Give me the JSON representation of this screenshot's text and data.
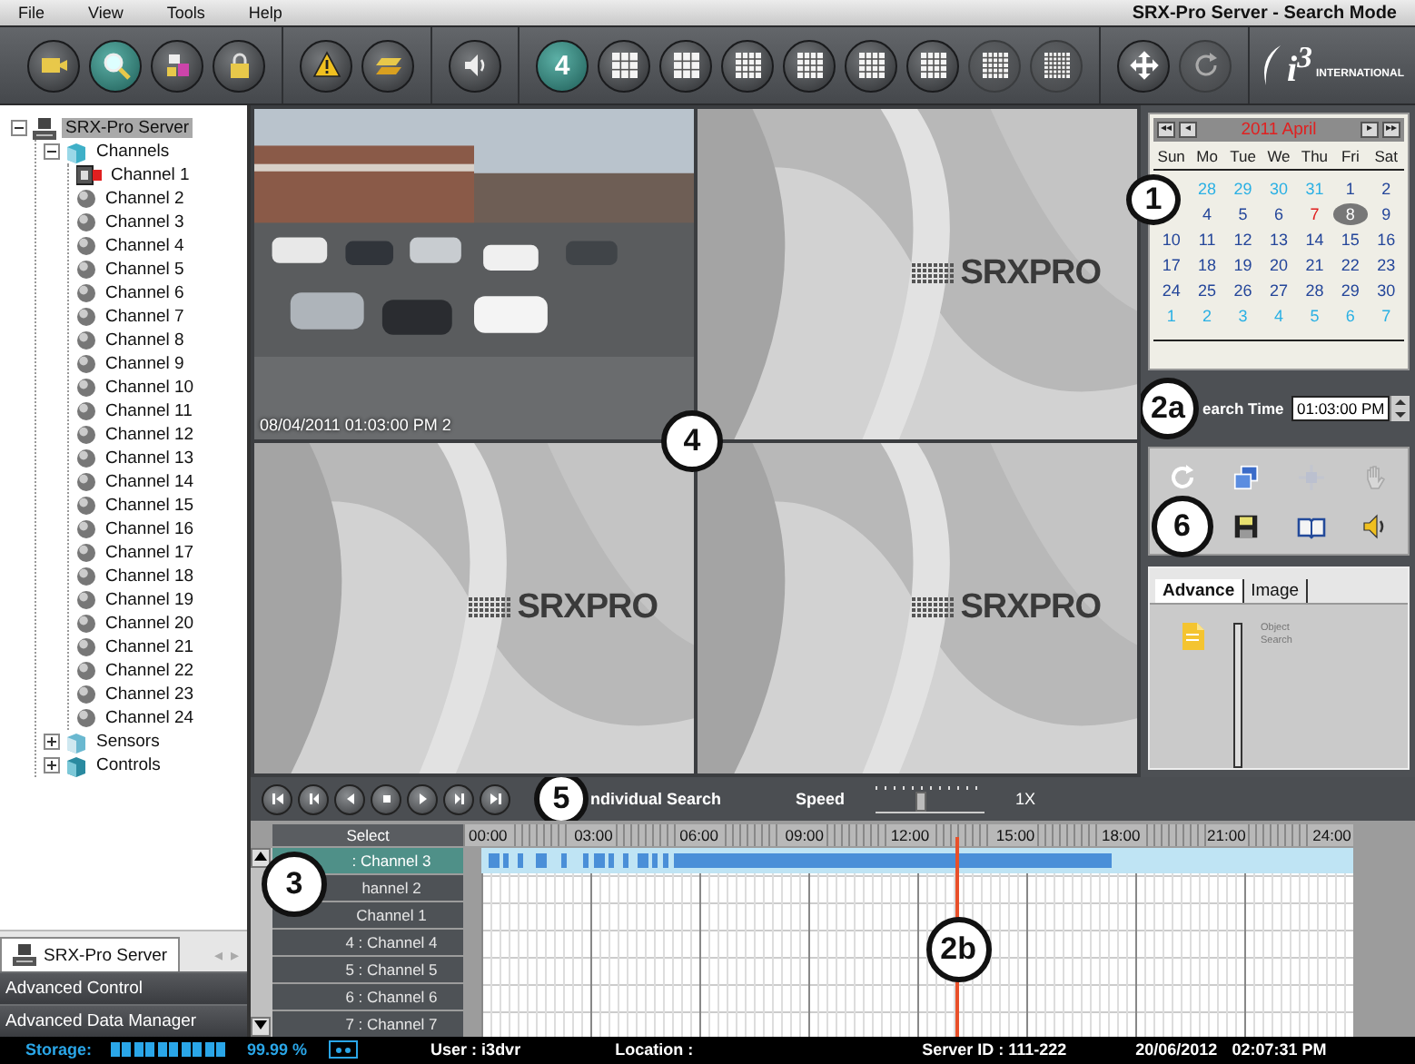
{
  "menu": {
    "items": [
      "File",
      "View",
      "Tools",
      "Help"
    ],
    "title": "SRX-Pro Server - Search Mode"
  },
  "toolbar": {
    "groups": [
      {
        "buttons": [
          {
            "kind": "camera",
            "selected": false,
            "disabled": false
          },
          {
            "kind": "search",
            "selected": true,
            "disabled": false
          },
          {
            "kind": "tools",
            "selected": false,
            "disabled": false
          },
          {
            "kind": "lock",
            "selected": false,
            "disabled": false
          }
        ]
      },
      {
        "buttons": [
          {
            "kind": "warning",
            "selected": false,
            "disabled": false
          },
          {
            "kind": "layers",
            "selected": false,
            "disabled": false
          }
        ]
      },
      {
        "buttons": [
          {
            "kind": "speaker",
            "selected": false,
            "disabled": false
          }
        ]
      },
      {
        "buttons": [
          {
            "kind": "number",
            "label": "4",
            "selected": true,
            "disabled": false
          },
          {
            "kind": "layout-6",
            "selected": false,
            "disabled": false
          },
          {
            "kind": "layout-9",
            "selected": false,
            "disabled": false
          },
          {
            "kind": "layout-8",
            "selected": false,
            "disabled": false
          },
          {
            "kind": "layout-10",
            "selected": false,
            "disabled": false
          },
          {
            "kind": "layout-13",
            "selected": false,
            "disabled": false
          },
          {
            "kind": "layout-16",
            "selected": false,
            "disabled": false
          },
          {
            "kind": "layout-25",
            "selected": false,
            "disabled": true
          },
          {
            "kind": "layout-36",
            "selected": false,
            "disabled": true
          }
        ]
      },
      {
        "buttons": [
          {
            "kind": "move",
            "selected": false,
            "disabled": false
          },
          {
            "kind": "refresh",
            "selected": false,
            "disabled": true
          }
        ]
      }
    ],
    "logo": {
      "mark": "i$^{3}$",
      "subtitle": "INTERNATIONAL"
    }
  },
  "tree": [
    {
      "label": "SRX-Pro Server",
      "kind": "server",
      "expanded": true,
      "selected": true,
      "children": [
        {
          "label": "Channels",
          "kind": "folder",
          "expanded": true,
          "selected": false,
          "children": [
            {
              "label": "Channel 1",
              "kind": "camera-recording",
              "selected": false
            },
            {
              "label": "Channel 2",
              "kind": "camera",
              "selected": false
            },
            {
              "label": "Channel 3",
              "kind": "camera",
              "selected": false
            },
            {
              "label": "Channel 4",
              "kind": "camera",
              "selected": false
            },
            {
              "label": "Channel 5",
              "kind": "camera",
              "selected": false
            },
            {
              "label": "Channel 6",
              "kind": "camera",
              "selected": false
            },
            {
              "label": "Channel 7",
              "kind": "camera",
              "selected": false
            },
            {
              "label": "Channel 8",
              "kind": "camera",
              "selected": false
            },
            {
              "label": "Channel 9",
              "kind": "camera",
              "selected": false
            },
            {
              "label": "Channel 10",
              "kind": "camera",
              "selected": false
            },
            {
              "label": "Channel 11",
              "kind": "camera",
              "selected": false
            },
            {
              "label": "Channel 12",
              "kind": "camera",
              "selected": false
            },
            {
              "label": "Channel 13",
              "kind": "camera",
              "selected": false
            },
            {
              "label": "Channel 14",
              "kind": "camera",
              "selected": false
            },
            {
              "label": "Channel 15",
              "kind": "camera",
              "selected": false
            },
            {
              "label": "Channel 16",
              "kind": "camera",
              "selected": false
            },
            {
              "label": "Channel 17",
              "kind": "camera",
              "selected": false
            },
            {
              "label": "Channel 18",
              "kind": "camera",
              "selected": false
            },
            {
              "label": "Channel 19",
              "kind": "camera",
              "selected": false
            },
            {
              "label": "Channel 20",
              "kind": "camera",
              "selected": false
            },
            {
              "label": "Channel 21",
              "kind": "camera",
              "selected": false
            },
            {
              "label": "Channel 22",
              "kind": "camera",
              "selected": false
            },
            {
              "label": "Channel 23",
              "kind": "camera",
              "selected": false
            },
            {
              "label": "Channel 24",
              "kind": "camera",
              "selected": false
            }
          ]
        },
        {
          "label": "Sensors",
          "kind": "sensor-folder",
          "expanded": false,
          "selected": false
        },
        {
          "label": "Controls",
          "kind": "control-folder",
          "expanded": false,
          "selected": false
        }
      ]
    }
  ],
  "left_tab": {
    "label": "SRX-Pro Server",
    "prev": "◂",
    "next": "▸"
  },
  "left_sections": [
    "Advanced Control",
    "Advanced Data Manager"
  ],
  "video": {
    "callout": "4",
    "tiles": [
      {
        "kind": "camera",
        "caption": "08/04/2011 01:03:00 PM 2"
      },
      {
        "kind": "logo",
        "logo": "SRXPRO"
      },
      {
        "kind": "logo",
        "logo": "SRXPRO"
      },
      {
        "kind": "logo",
        "logo": "SRXPRO"
      }
    ]
  },
  "calendar": {
    "title": "2011 April",
    "first": "◂◂",
    "prev": "◂",
    "next": "▸",
    "last": "▸▸",
    "callout": "1",
    "weekdays": [
      "Sun",
      "Mo",
      "Tue",
      "We",
      "Thu",
      "Fri",
      "Sat"
    ],
    "weeks": [
      [
        {
          "kind": "covered"
        },
        {
          "day": "28",
          "kind": "other-month",
          "selected": false
        },
        {
          "day": "29",
          "kind": "other-month",
          "selected": false
        },
        {
          "day": "30",
          "kind": "other-month",
          "selected": false
        },
        {
          "day": "31",
          "kind": "other-month",
          "selected": false
        },
        {
          "day": "1",
          "kind": "month",
          "selected": false
        },
        {
          "day": "2",
          "kind": "month",
          "selected": false
        }
      ],
      [
        {
          "kind": "covered"
        },
        {
          "day": "4",
          "kind": "month",
          "selected": false
        },
        {
          "day": "5",
          "kind": "month",
          "selected": false
        },
        {
          "day": "6",
          "kind": "month",
          "selected": false
        },
        {
          "day": "7",
          "kind": "marked",
          "selected": false
        },
        {
          "day": "8",
          "kind": "month",
          "selected": true
        },
        {
          "day": "9",
          "kind": "month",
          "selected": false
        }
      ],
      [
        {
          "day": "10",
          "kind": "month",
          "selected": false
        },
        {
          "day": "11",
          "kind": "month",
          "selected": false
        },
        {
          "day": "12",
          "kind": "month",
          "selected": false
        },
        {
          "day": "13",
          "kind": "month",
          "selected": false
        },
        {
          "day": "14",
          "kind": "month",
          "selected": false
        },
        {
          "day": "15",
          "kind": "month",
          "selected": false
        },
        {
          "day": "16",
          "kind": "month",
          "selected": false
        }
      ],
      [
        {
          "day": "17",
          "kind": "month",
          "selected": false
        },
        {
          "day": "18",
          "kind": "month",
          "selected": false
        },
        {
          "day": "19",
          "kind": "month",
          "selected": false
        },
        {
          "day": "20",
          "kind": "month",
          "selected": false
        },
        {
          "day": "21",
          "kind": "month",
          "selected": false
        },
        {
          "day": "22",
          "kind": "month",
          "selected": false
        },
        {
          "day": "23",
          "kind": "month",
          "selected": false
        }
      ],
      [
        {
          "day": "24",
          "kind": "month",
          "selected": false
        },
        {
          "day": "25",
          "kind": "month",
          "selected": false
        },
        {
          "day": "26",
          "kind": "month",
          "selected": false
        },
        {
          "day": "27",
          "kind": "month",
          "selected": false
        },
        {
          "day": "28",
          "kind": "month",
          "selected": false
        },
        {
          "day": "29",
          "kind": "month",
          "selected": false
        },
        {
          "day": "30",
          "kind": "month",
          "selected": false
        }
      ],
      [
        {
          "day": "1",
          "kind": "other-month",
          "selected": false
        },
        {
          "day": "2",
          "kind": "other-month",
          "selected": false
        },
        {
          "day": "3",
          "kind": "other-month",
          "selected": false
        },
        {
          "day": "4",
          "kind": "other-month",
          "selected": false
        },
        {
          "day": "5",
          "kind": "other-month",
          "selected": false
        },
        {
          "day": "6",
          "kind": "other-month",
          "selected": false
        },
        {
          "day": "7",
          "kind": "other-month",
          "selected": false
        }
      ]
    ]
  },
  "search_time": {
    "callout": "2a",
    "label": "earch Time",
    "value": "01:03:00 PM"
  },
  "tools": {
    "callout": "6",
    "icons": [
      {
        "kind": "refresh",
        "disabled": false
      },
      {
        "kind": "windows",
        "disabled": false
      },
      {
        "kind": "move",
        "disabled": true
      },
      {
        "kind": "hand",
        "disabled": true
      },
      {
        "kind": "save",
        "disabled": false
      },
      {
        "kind": "book",
        "disabled": false
      },
      {
        "kind": "speaker",
        "disabled": false
      }
    ]
  },
  "advanced": {
    "tabs": [
      {
        "label": "Advance",
        "selected": true
      },
      {
        "label": "Image",
        "selected": false
      }
    ],
    "item": "Object Search"
  },
  "playback": {
    "buttons": [
      {
        "kind": "first"
      },
      {
        "kind": "prev-mark"
      },
      {
        "kind": "back"
      },
      {
        "kind": "stop"
      },
      {
        "kind": "play"
      },
      {
        "kind": "next-mark"
      },
      {
        "kind": "last"
      }
    ],
    "callout": "5",
    "mode": "ndividual Search",
    "speed_label": "Speed",
    "speed": {
      "level": 0.42
    },
    "speed_value": "1X"
  },
  "timeline": {
    "select": "Select",
    "callout": "3",
    "marker_callout": "2b",
    "hours": [
      "00:00",
      "03:00",
      "06:00",
      "09:00",
      "12:00",
      "15:00",
      "18:00",
      "21:00",
      "24:00"
    ],
    "channels": [
      {
        "label": ": Channel 3",
        "selected": true
      },
      {
        "label": "hannel 2",
        "selected": false
      },
      {
        "label": "Channel 1",
        "selected": false
      },
      {
        "label": "4 : Channel 4",
        "selected": false
      },
      {
        "label": "5 : Channel 5",
        "selected": false
      },
      {
        "label": "6 : Channel 6",
        "selected": false
      },
      {
        "label": "7 : Channel 7",
        "selected": false
      }
    ],
    "marker": {
      "level": 0.545
    }
  },
  "status": {
    "storage_label": "Storage:",
    "storage": {
      "level": 0.9999
    },
    "storage_value": "99.99 %",
    "user": "User : i3dvr",
    "location": "Location :",
    "server_id": "Server ID : 111-222",
    "date": "20/06/2012",
    "time": "02:07:31 PM"
  }
}
